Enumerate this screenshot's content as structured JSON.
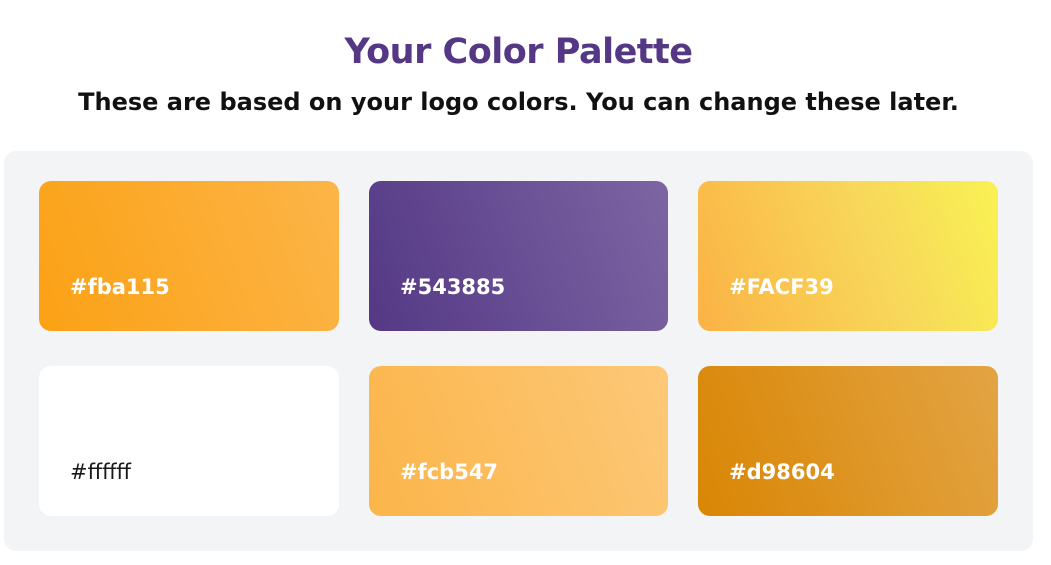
{
  "header": {
    "title": "Your Color Palette",
    "subtitle": "These are based on your logo colors. You can change these later."
  },
  "palette": {
    "swatches": [
      {
        "label": "#fba115",
        "color": "#fba115"
      },
      {
        "label": "#543885",
        "color": "#543885"
      },
      {
        "label": "#FACF39",
        "color": "#FACF39"
      },
      {
        "label": "#ffffff",
        "color": "#ffffff"
      },
      {
        "label": "#fcb547",
        "color": "#fcb547"
      },
      {
        "label": "#d98604",
        "color": "#d98604"
      }
    ]
  }
}
